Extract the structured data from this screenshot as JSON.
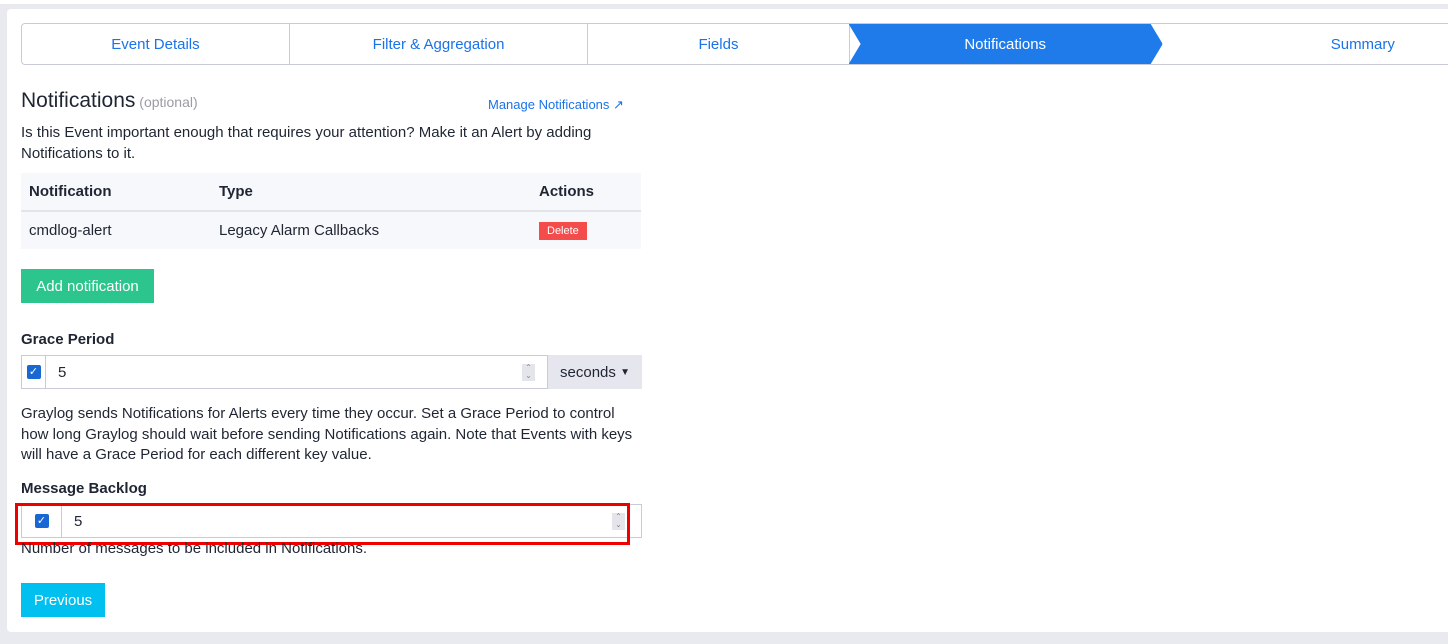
{
  "steps": [
    {
      "label": "Event Details"
    },
    {
      "label": "Filter & Aggregation"
    },
    {
      "label": "Fields"
    },
    {
      "label": "Notifications"
    },
    {
      "label": "Summary"
    }
  ],
  "title": "Notifications",
  "optional": "(optional)",
  "manage_link": "Manage Notifications",
  "intro": "Is this Event important enough that requires your attention? Make it an Alert by adding Notifications to it.",
  "table": {
    "headers": [
      "Notification",
      "Type",
      "Actions"
    ],
    "rows": [
      {
        "name": "cmdlog-alert",
        "type": "Legacy Alarm Callbacks",
        "action": "Delete"
      }
    ]
  },
  "add_button": "Add notification",
  "grace": {
    "label": "Grace Period",
    "value": "5",
    "unit": "seconds",
    "checked": true,
    "help": "Graylog sends Notifications for Alerts every time they occur. Set a Grace Period to control how long Graylog should wait before sending Notifications again. Note that Events with keys will have a Grace Period for each different key value."
  },
  "backlog": {
    "label": "Message Backlog",
    "value": "5",
    "checked": true,
    "help": "Number of messages to be included in Notifications."
  },
  "previous_button": "Previous",
  "colors": {
    "accent": "#1e7be9",
    "success": "#2bc58d",
    "danger": "#f44b4b",
    "info": "#00c0f0",
    "highlight": "#ee0000"
  }
}
